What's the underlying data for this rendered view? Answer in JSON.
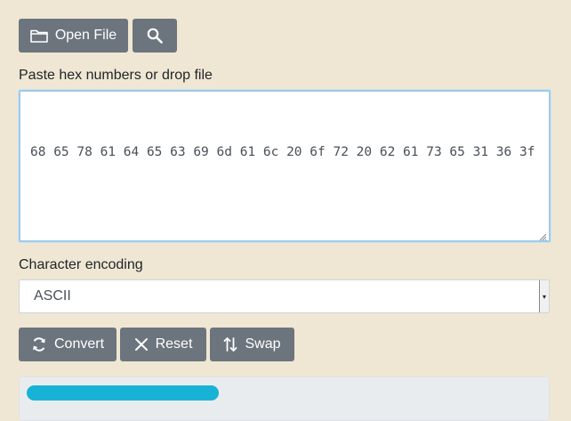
{
  "toolbar": {
    "open_file_label": "Open File",
    "folder_icon": "folder-icon",
    "search_icon": "search-icon"
  },
  "input": {
    "label": "Paste hex numbers or drop file",
    "value": "68 65 78 61 64 65 63 69 6d 61 6c 20 6f 72 20 62 61 73 65 31 36 3f"
  },
  "encoding": {
    "label": "Character encoding",
    "selected": "ASCII"
  },
  "actions": {
    "convert_label": "Convert",
    "reset_label": "Reset",
    "swap_label": "Swap",
    "convert_icon": "refresh-icon",
    "reset_icon": "close-icon",
    "swap_icon": "swap-icon"
  },
  "colors": {
    "page_bg": "#efe7d3",
    "button_bg": "#6c757d",
    "focus_border": "#9ecbe8",
    "redaction": "#18b2d6"
  }
}
